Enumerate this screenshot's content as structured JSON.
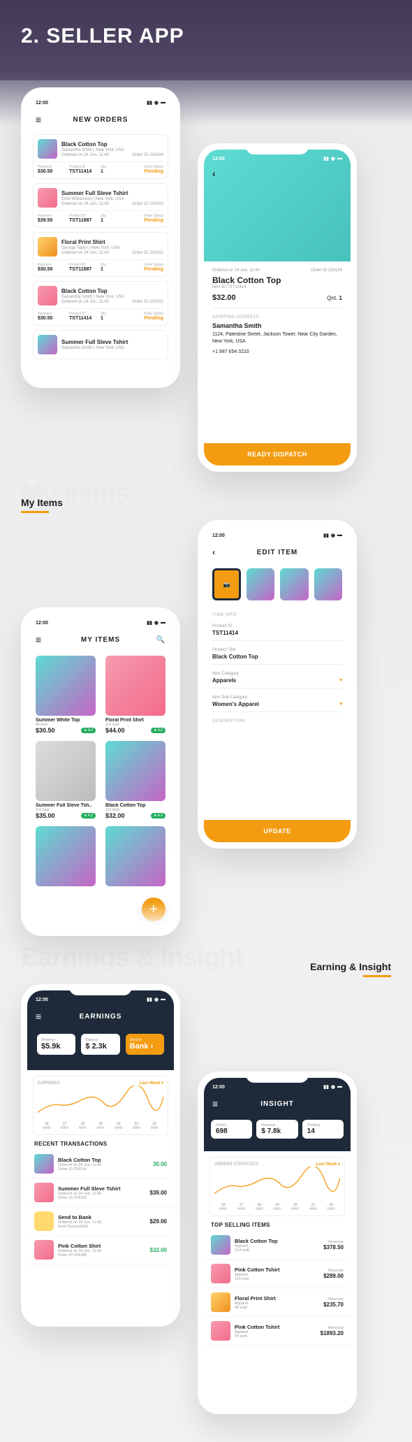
{
  "hero_title": "2. SELLER APP",
  "status_time": "12:00",
  "sections": {
    "my_items_bg": "My items",
    "my_items": "My Items",
    "earnings_bg": "Earnings & Insight",
    "earnings": "Earning & Insight"
  },
  "new_orders": {
    "title": "NEW ORDERS",
    "cols": {
      "payment": "Payment",
      "product_id": "Product ID",
      "qty": "Qty.",
      "status": "Order Status"
    },
    "items": [
      {
        "title": "Black Cotton Top",
        "sub": "Samantha Smith | New York, USA",
        "date": "Ordered on 24 Jun, 11:40",
        "oid": "Order ID 224154",
        "payment": "$30.50",
        "pid": "TST11414",
        "qty": "1",
        "status": "Pending"
      },
      {
        "title": "Summer Full Sleve Tshirt",
        "sub": "Emili Williamson | New York, USA",
        "date": "Ordered on 24 Jun, 11:40",
        "oid": "Order ID 224153",
        "payment": "$39.50",
        "pid": "TST11887",
        "qty": "1",
        "status": "Pending"
      },
      {
        "title": "Floral Print Shirt",
        "sub": "George Taylor | New York, USA",
        "date": "Ordered on 24 Jun, 11:40",
        "oid": "Order ID 224152",
        "payment": "$30.50",
        "pid": "TST11887",
        "qty": "1",
        "status": "Pending"
      },
      {
        "title": "Black Cotton Top",
        "sub": "Samantha Smith | New York, USA",
        "date": "Ordered on 24 Jun, 11:40",
        "oid": "Order ID 224151",
        "payment": "$30.50",
        "pid": "TST11414",
        "qty": "1",
        "status": "Pending"
      },
      {
        "title": "Summer Full Sleve Tshirt",
        "sub": "Samantha Smith | New York, USA",
        "date": "",
        "oid": "",
        "payment": "",
        "pid": "",
        "qty": "",
        "status": ""
      }
    ]
  },
  "order_detail": {
    "date": "Ordered on 24 Jun, 11:40",
    "oid": "Order ID 224154",
    "title": "Black Cotton Top",
    "item_id": "Item ID TST11414",
    "price": "$32.00",
    "qnt_lbl": "Qnt.",
    "qnt": "1",
    "ship_h": "SHIPPING ADDRESS",
    "name": "Samantha Smith",
    "addr": "1124, Patestine Street, Jackson Tower, Near City Garden, New York, USA",
    "phone": "+1 987 654 3210",
    "btn": "READY DISPATCH"
  },
  "my_items_screen": {
    "title": "MY ITEMS",
    "items": [
      {
        "title": "Summer White Top",
        "sold": "48 Sold",
        "price": "$30.50",
        "rating": "4.2"
      },
      {
        "title": "Floral Print Shirt",
        "sold": "119 Sold",
        "price": "$44.00",
        "rating": "4.2"
      },
      {
        "title": "Summer Full Sleve Tsh..",
        "sold": "119 Sold",
        "price": "$35.00",
        "rating": "4.2"
      },
      {
        "title": "Black Cotton Top",
        "sold": "124 Sold",
        "price": "$32.00",
        "rating": "4.2"
      },
      {
        "title": "",
        "sold": "",
        "price": "",
        "rating": ""
      },
      {
        "title": "",
        "sold": "",
        "price": "",
        "rating": ""
      }
    ]
  },
  "edit_item": {
    "title": "EDIT ITEM",
    "info_h": "ITEM INFO",
    "fields": {
      "pid_lbl": "Product ID",
      "pid": "TST11414",
      "ptitle_lbl": "Product Title",
      "ptitle": "Black Cotton Top",
      "cat_lbl": "Item Category",
      "cat": "Apparels",
      "subcat_lbl": "Item Sub Category",
      "subcat": "Women's Apparel"
    },
    "desc_h": "DESCRIPTION",
    "btn": "UPDATE"
  },
  "earnings": {
    "title": "EARNINGS",
    "boxes": {
      "revenue_lbl": "Revenue",
      "revenue": "$5.9k",
      "balance_lbl": "Balance",
      "balance": "$ 2.3k",
      "send_lbl": "Send to",
      "send": "Bank"
    },
    "chart_h": "EARNINGS",
    "chart_dd": "Last Week",
    "recent_h": "RECENT TRANSACTIONS",
    "transactions": [
      {
        "title": "Black Cotton Top",
        "sub1": "Ordered on 24 Jun, 11:40",
        "sub2": "Order ID 224154",
        "amt": "30.00",
        "cls": "green"
      },
      {
        "title": "Summer Full Sleve Tshirt",
        "sub1": "Ordered on 24 Jun, 11:40",
        "sub2": "Order ID 224151",
        "amt": "$39.00",
        "cls": ""
      },
      {
        "title": "Send to Bank",
        "sub1": "Ordered on 24 Jun, 11:40",
        "sub2": "Sent Successfully",
        "amt": "$29.00",
        "cls": ""
      },
      {
        "title": "Pink Cotton Shirt",
        "sub1": "Ordered on 24 Jun, 11:40",
        "sub2": "Order ID 224188",
        "amt": "$32.00",
        "cls": "green"
      }
    ]
  },
  "insight": {
    "title": "INSIGHT",
    "boxes": {
      "orders_lbl": "Orders",
      "orders": "698",
      "revenue_lbl": "Revenue",
      "revenue": "$ 7.8k",
      "pending_lbl": "Pending",
      "pending": "14"
    },
    "chart_h": "ORDERS STATASTICS",
    "chart_dd": "Last Week",
    "top_h": "TOP SELLING ITEMS",
    "rev_lbl": "Revenue",
    "items": [
      {
        "title": "Black Cotton Top",
        "cat": "Apparel",
        "sold": "124 sold",
        "rev": "$378.50"
      },
      {
        "title": "Pink Cotton Tshirt",
        "cat": "Apparel",
        "sold": "119 sold",
        "rev": "$289.00"
      },
      {
        "title": "Floral Print Shirt",
        "cat": "Apparel",
        "sold": "98 sold",
        "rev": "$235.70"
      },
      {
        "title": "Pink Cotton Tshirt",
        "cat": "Apparel",
        "sold": "79 sold",
        "rev": "$1893.20"
      }
    ]
  },
  "chart_data": {
    "type": "line",
    "categories": [
      "16 MAR",
      "17 MAR",
      "18 MAR",
      "19 MAR",
      "20 MAR",
      "21 MAR",
      "22 MAR"
    ],
    "values": [
      20,
      38,
      30,
      50,
      42,
      62,
      48
    ]
  }
}
